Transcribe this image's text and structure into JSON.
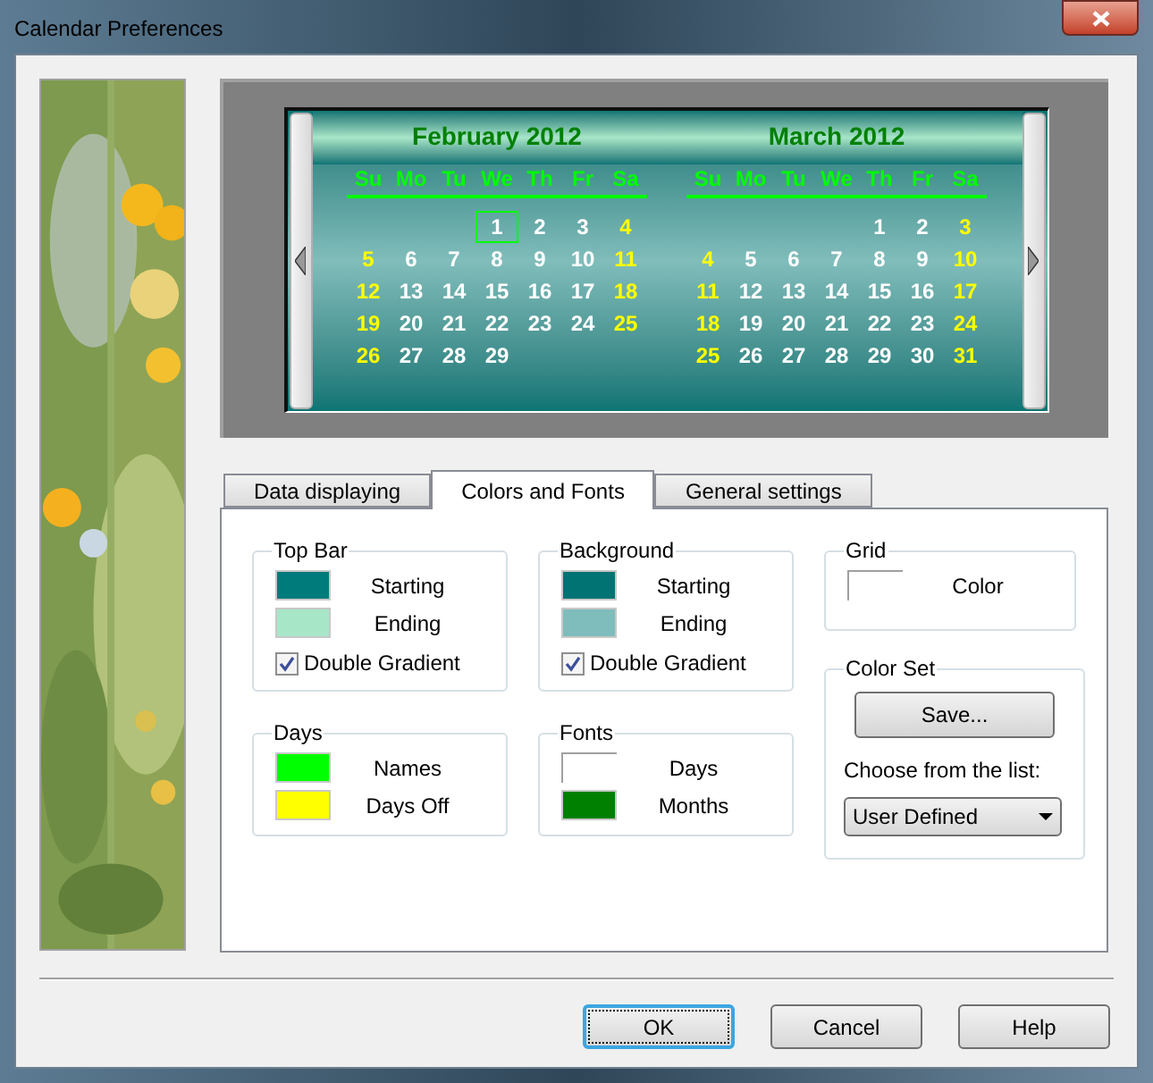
{
  "window": {
    "title": "Calendar Preferences"
  },
  "calendar": {
    "months": [
      {
        "title": "February 2012",
        "weekdays": [
          {
            "label": "Su"
          },
          {
            "label": "Mo"
          },
          {
            "label": "Tu"
          },
          {
            "label": "We"
          },
          {
            "label": "Th"
          },
          {
            "label": "Fr"
          },
          {
            "label": "Sa"
          }
        ],
        "weeks": [
          {
            "days": [
              {
                "day": "1",
                "off": false,
                "selected": true
              },
              {
                "day": "2",
                "off": false,
                "selected": false
              },
              {
                "day": "3",
                "off": false,
                "selected": false
              },
              {
                "day": "4",
                "off": true,
                "selected": false
              }
            ]
          },
          {
            "days": [
              {
                "day": "5",
                "off": true,
                "selected": false
              },
              {
                "day": "6",
                "off": false,
                "selected": false
              },
              {
                "day": "7",
                "off": false,
                "selected": false
              },
              {
                "day": "8",
                "off": false,
                "selected": false
              },
              {
                "day": "9",
                "off": false,
                "selected": false
              },
              {
                "day": "10",
                "off": false,
                "selected": false
              },
              {
                "day": "11",
                "off": true,
                "selected": false
              }
            ]
          },
          {
            "days": [
              {
                "day": "12",
                "off": true,
                "selected": false
              },
              {
                "day": "13",
                "off": false,
                "selected": false
              },
              {
                "day": "14",
                "off": false,
                "selected": false
              },
              {
                "day": "15",
                "off": false,
                "selected": false
              },
              {
                "day": "16",
                "off": false,
                "selected": false
              },
              {
                "day": "17",
                "off": false,
                "selected": false
              },
              {
                "day": "18",
                "off": true,
                "selected": false
              }
            ]
          },
          {
            "days": [
              {
                "day": "19",
                "off": true,
                "selected": false
              },
              {
                "day": "20",
                "off": false,
                "selected": false
              },
              {
                "day": "21",
                "off": false,
                "selected": false
              },
              {
                "day": "22",
                "off": false,
                "selected": false
              },
              {
                "day": "23",
                "off": false,
                "selected": false
              },
              {
                "day": "24",
                "off": false,
                "selected": false
              },
              {
                "day": "25",
                "off": true,
                "selected": false
              }
            ]
          },
          {
            "days": [
              {
                "day": "26",
                "off": true,
                "selected": false
              },
              {
                "day": "27",
                "off": false,
                "selected": false
              },
              {
                "day": "28",
                "off": false,
                "selected": false
              },
              {
                "day": "29",
                "off": false,
                "selected": false
              }
            ]
          }
        ]
      },
      {
        "title": "March 2012",
        "weekdays": [
          {
            "label": "Su"
          },
          {
            "label": "Mo"
          },
          {
            "label": "Tu"
          },
          {
            "label": "We"
          },
          {
            "label": "Th"
          },
          {
            "label": "Fr"
          },
          {
            "label": "Sa"
          }
        ],
        "weeks": [
          {
            "days": [
              {
                "day": "1",
                "off": false,
                "selected": false
              },
              {
                "day": "2",
                "off": false,
                "selected": false
              },
              {
                "day": "3",
                "off": true,
                "selected": false
              }
            ]
          },
          {
            "days": [
              {
                "day": "4",
                "off": true,
                "selected": false
              },
              {
                "day": "5",
                "off": false,
                "selected": false
              },
              {
                "day": "6",
                "off": false,
                "selected": false
              },
              {
                "day": "7",
                "off": false,
                "selected": false
              },
              {
                "day": "8",
                "off": false,
                "selected": false
              },
              {
                "day": "9",
                "off": false,
                "selected": false
              },
              {
                "day": "10",
                "off": true,
                "selected": false
              }
            ]
          },
          {
            "days": [
              {
                "day": "11",
                "off": true,
                "selected": false
              },
              {
                "day": "12",
                "off": false,
                "selected": false
              },
              {
                "day": "13",
                "off": false,
                "selected": false
              },
              {
                "day": "14",
                "off": false,
                "selected": false
              },
              {
                "day": "15",
                "off": false,
                "selected": false
              },
              {
                "day": "16",
                "off": false,
                "selected": false
              },
              {
                "day": "17",
                "off": true,
                "selected": false
              }
            ]
          },
          {
            "days": [
              {
                "day": "18",
                "off": true,
                "selected": false
              },
              {
                "day": "19",
                "off": false,
                "selected": false
              },
              {
                "day": "20",
                "off": false,
                "selected": false
              },
              {
                "day": "21",
                "off": false,
                "selected": false
              },
              {
                "day": "22",
                "off": false,
                "selected": false
              },
              {
                "day": "23",
                "off": false,
                "selected": false
              },
              {
                "day": "24",
                "off": true,
                "selected": false
              }
            ]
          },
          {
            "days": [
              {
                "day": "25",
                "off": true,
                "selected": false
              },
              {
                "day": "26",
                "off": false,
                "selected": false
              },
              {
                "day": "27",
                "off": false,
                "selected": false
              },
              {
                "day": "28",
                "off": false,
                "selected": false
              },
              {
                "day": "29",
                "off": false,
                "selected": false
              },
              {
                "day": "30",
                "off": false,
                "selected": false
              },
              {
                "day": "31",
                "off": true,
                "selected": false
              }
            ]
          }
        ]
      }
    ]
  },
  "tabs": [
    {
      "label": "Data displaying",
      "selected": false
    },
    {
      "label": "Colors and Fonts",
      "selected": true
    },
    {
      "label": "General settings",
      "selected": false
    }
  ],
  "groups": [
    {
      "title": "Top Bar",
      "swatches": [
        {
          "label": "Starting",
          "color": "#007b7b"
        },
        {
          "label": "Ending",
          "color": "#a8e6c8"
        }
      ],
      "checkbox": {
        "label": "Double Gradient",
        "checked": true
      }
    },
    {
      "title": "Background",
      "swatches": [
        {
          "label": "Starting",
          "color": "#007372"
        },
        {
          "label": "Ending",
          "color": "#7fbcbc"
        }
      ],
      "checkbox": {
        "label": "Double Gradient",
        "checked": true
      }
    },
    {
      "title": "Days",
      "swatches": [
        {
          "label": "Names",
          "color": "#00ff00"
        },
        {
          "label": "Days Off",
          "color": "#ffff00"
        }
      ]
    },
    {
      "title": "Fonts",
      "swatches": [
        {
          "label": "Days",
          "color": "#ffffff"
        },
        {
          "label": "Months",
          "color": "#008000"
        }
      ]
    }
  ],
  "grid": {
    "title": "Grid",
    "swatches": [
      {
        "label": "Color",
        "color": "#ffffff"
      }
    ]
  },
  "color_set": {
    "title": "Color Set",
    "button": "Save...",
    "list_label": "Choose from the list:",
    "dropdown": {
      "value": "User Defined"
    }
  },
  "buttons": [
    {
      "label": "OK",
      "default": true
    },
    {
      "label": "Cancel",
      "default": false
    },
    {
      "label": "Help",
      "default": false
    }
  ]
}
